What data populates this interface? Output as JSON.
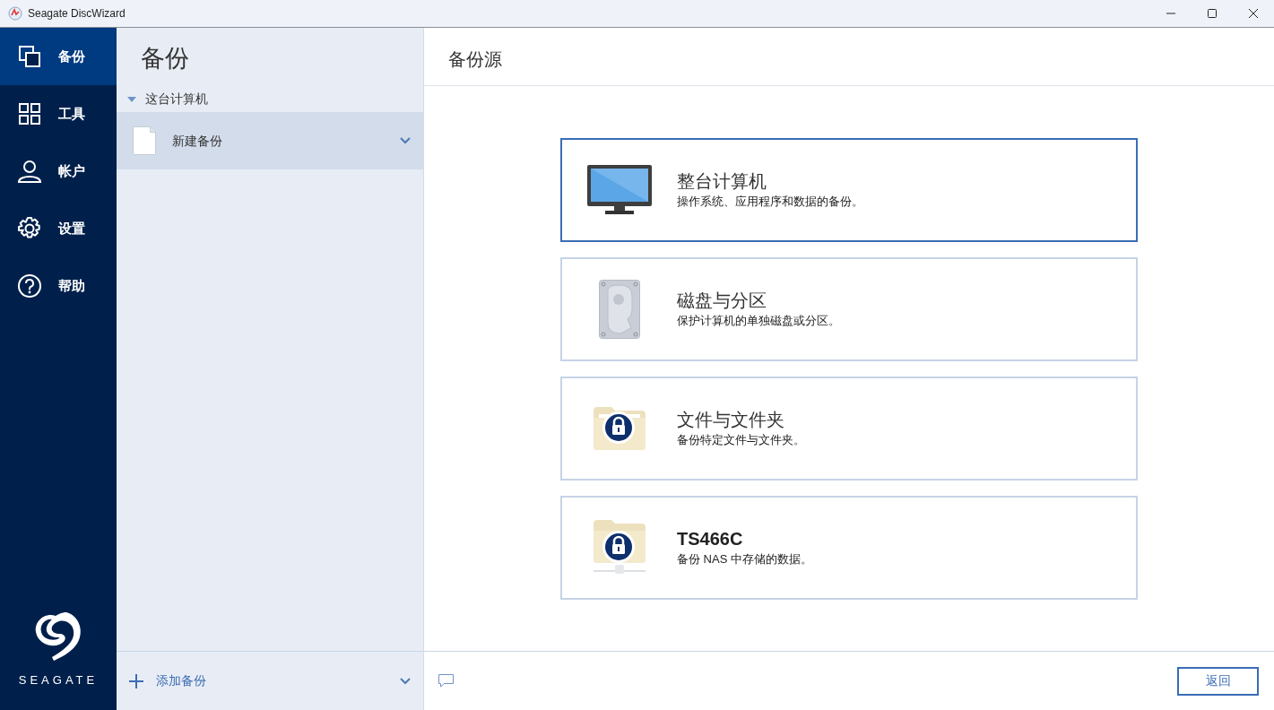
{
  "window": {
    "title": "Seagate DiscWizard"
  },
  "nav": {
    "items": [
      {
        "label": "备份",
        "selected": true
      },
      {
        "label": "工具",
        "selected": false
      },
      {
        "label": "帐户",
        "selected": false
      },
      {
        "label": "设置",
        "selected": false
      },
      {
        "label": "帮助",
        "selected": false
      }
    ],
    "logo_text": "SEAGATE"
  },
  "backups_panel": {
    "title": "备份",
    "groups": [
      {
        "label": "这台计算机",
        "expanded": true,
        "items": [
          {
            "label": "新建备份",
            "selected": true
          }
        ]
      }
    ],
    "add_button": "添加备份"
  },
  "main": {
    "title": "备份源",
    "sources": [
      {
        "kind": "computer",
        "title": "整台计算机",
        "description": "操作系统、应用程序和数据的备份。",
        "selected": true
      },
      {
        "kind": "disk",
        "title": "磁盘与分区",
        "description": "保护计算机的单独磁盘或分区。",
        "selected": false
      },
      {
        "kind": "folder",
        "title": "文件与文件夹",
        "description": "备份特定文件与文件夹。",
        "selected": false
      },
      {
        "kind": "nas",
        "title": "TS466C",
        "description": "备份 NAS 中存储的数据。",
        "selected": false
      }
    ],
    "back_button": "返回"
  }
}
